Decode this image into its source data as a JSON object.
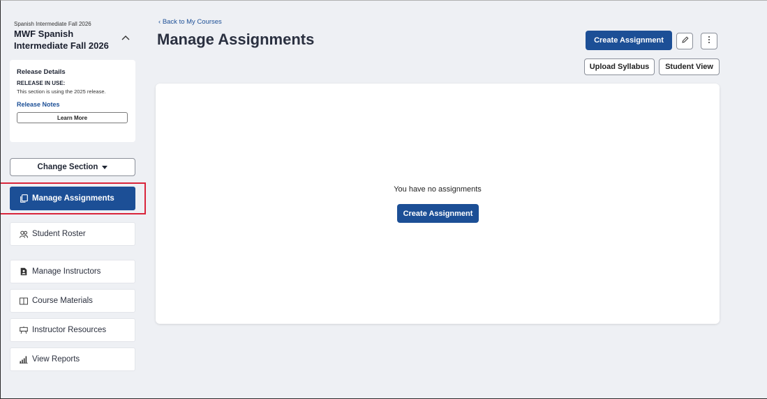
{
  "course": {
    "term": "Spanish Intermediate Fall 2026",
    "name": "MWF Spanish Intermediate Fall 2026"
  },
  "release": {
    "title": "Release Details",
    "in_use_label": "RELEASE IN USE:",
    "description": "This section is using the 2025 release.",
    "notes_link": "Release Notes",
    "learn_more": "Learn More"
  },
  "change_section": "Change Section",
  "nav": {
    "items": [
      {
        "label": "Manage Assignments",
        "icon": "document-icon",
        "active": true
      },
      {
        "label": "Student Roster",
        "icon": "users-icon",
        "active": false
      },
      {
        "label": "Manage Instructors",
        "icon": "instructor-icon",
        "active": false
      },
      {
        "label": "Course Materials",
        "icon": "book-icon",
        "active": false
      },
      {
        "label": "Instructor Resources",
        "icon": "presentation-icon",
        "active": false
      },
      {
        "label": "View Reports",
        "icon": "bar-chart-icon",
        "active": false
      }
    ]
  },
  "header": {
    "back_link": "Back to My Courses",
    "title": "Manage Assignments",
    "create_assignment": "Create Assignment",
    "upload_syllabus": "Upload Syllabus",
    "student_view": "Student View"
  },
  "empty_state": {
    "message": "You have no assignments",
    "button": "Create Assignment"
  },
  "colors": {
    "primary": "#1c4f96",
    "highlight": "#d9243a",
    "background": "#eef0f4"
  }
}
